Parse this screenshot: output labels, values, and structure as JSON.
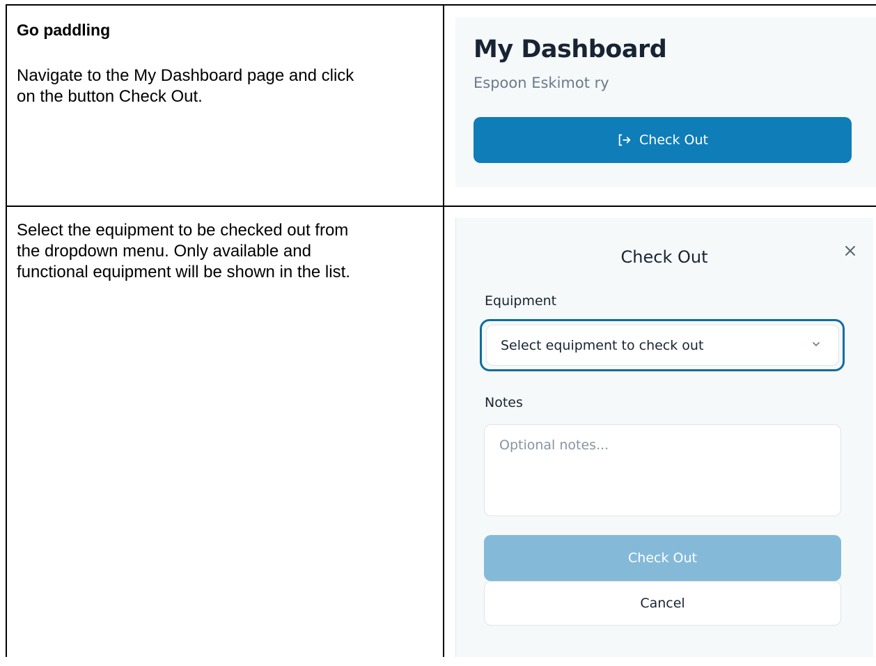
{
  "row1": {
    "heading": "Go paddling",
    "instruction_line1": "Navigate to the My Dashboard page and click",
    "instruction_line2": "on the button Check Out."
  },
  "dashboard": {
    "title": "My Dashboard",
    "organization": "Espoon Eskimot ry",
    "checkout_button_label": "Check Out",
    "checkout_icon": "log-out-icon",
    "accent_color": "#0f7db8"
  },
  "row2": {
    "instruction_line1": "Select the equipment to be checked out from",
    "instruction_line2": "the dropdown menu. Only available and",
    "instruction_line3": "functional equipment will be shown in the list."
  },
  "modal": {
    "title": "Check Out",
    "close_icon": "close-icon",
    "equipment_label": "Equipment",
    "equipment_select_value": "Select equipment to check out",
    "dropdown_icon": "chevron-down-icon",
    "notes_label": "Notes",
    "notes_placeholder": "Optional notes...",
    "submit_label": "Check Out",
    "cancel_label": "Cancel",
    "submit_color": "#84bad8",
    "focus_color": "#0f6d9f"
  }
}
